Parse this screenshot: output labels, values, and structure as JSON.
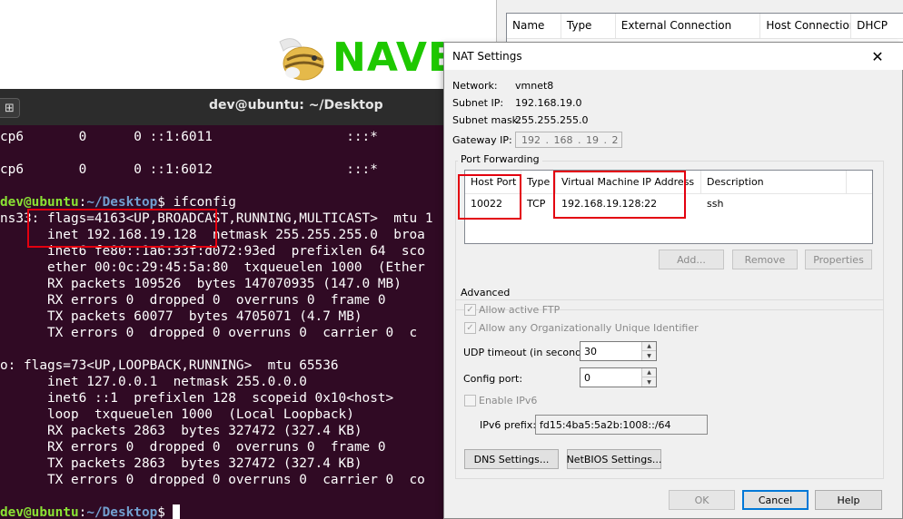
{
  "logo": {
    "text": "NAVE"
  },
  "network_list": {
    "columns": [
      "Name",
      "Type",
      "External Connection",
      "Host Connection",
      "DHCP"
    ]
  },
  "terminal": {
    "title": "dev@ubuntu: ~/Desktop",
    "prompt_user": "dev@ubuntu",
    "prompt_colon": ":",
    "prompt_path": "~/Desktop",
    "prompt_symbol": "$",
    "command": " ifconfig",
    "lines": {
      "tcp6_a": "cp6       0      0 ::1:6011                 :::*",
      "tcp6_b": "cp6       0      0 ::1:6012                 :::*",
      "ens_flags": "ns33: flags=4163<UP,BROADCAST,RUNNING,MULTICAST>  mtu 1",
      "ens_inet": "      inet 192.168.19.128  netmask 255.255.255.0  broa",
      "ens_inet6": "      inet6 fe80::1a6:33f:d072:93ed  prefixlen 64  sco",
      "ens_ether": "      ether 00:0c:29:45:5a:80  txqueuelen 1000  (Ether",
      "ens_rxp": "      RX packets 109526  bytes 147070935 (147.0 MB)",
      "ens_rxe": "      RX errors 0  dropped 0  overruns 0  frame 0",
      "ens_txp": "      TX packets 60077  bytes 4705071 (4.7 MB)",
      "ens_txe": "      TX errors 0  dropped 0 overruns 0  carrier 0  c",
      "lo_flags": "o: flags=73<UP,LOOPBACK,RUNNING>  mtu 65536",
      "lo_inet": "      inet 127.0.0.1  netmask 255.0.0.0",
      "lo_inet6": "      inet6 ::1  prefixlen 128  scopeid 0x10<host>",
      "lo_loop": "      loop  txqueuelen 1000  (Local Loopback)",
      "lo_rxp": "      RX packets 2863  bytes 327472 (327.4 KB)",
      "lo_rxe": "      RX errors 0  dropped 0  overruns 0  frame 0",
      "lo_txp": "      TX packets 2863  bytes 327472 (327.4 KB)",
      "lo_txe": "      TX errors 0  dropped 0 overruns 0  carrier 0  co"
    }
  },
  "nat_dialog": {
    "title": "NAT Settings",
    "close_glyph": "✕",
    "network_label": "Network:",
    "network_value": "vmnet8",
    "subnet_ip_label": "Subnet IP:",
    "subnet_ip_value": "192.168.19.0",
    "subnet_mask_label": "Subnet mask:",
    "subnet_mask_value": "255.255.255.0",
    "gateway_label": "Gateway IP:",
    "gateway_value": "192 . 168 . 19 . 2",
    "port_forwarding": {
      "title": "Port Forwarding",
      "columns": [
        "Host Port",
        "Type",
        "Virtual Machine IP Address",
        "Description"
      ],
      "rows": [
        {
          "host_port": "10022",
          "type": "TCP",
          "vm_ip": "192.168.19.128:22",
          "description": "ssh"
        }
      ],
      "add_label": "Add...",
      "remove_label": "Remove",
      "properties_label": "Properties"
    },
    "advanced": {
      "title": "Advanced",
      "allow_ftp_label": "Allow active FTP",
      "allow_ftp_checked": true,
      "allow_oui_label": "Allow any Organizationally Unique Identifier",
      "allow_oui_checked": true,
      "udp_timeout_label": "UDP timeout (in seconds):",
      "udp_timeout_value": "30",
      "config_port_label": "Config port:",
      "config_port_value": "0",
      "enable_ipv6_label": "Enable IPv6",
      "enable_ipv6_checked": false,
      "ipv6_prefix_label": "IPv6 prefix:",
      "ipv6_prefix_value": "fd15:4ba5:5a2b:1008::/64"
    },
    "dns_settings_label": "DNS Settings...",
    "netbios_settings_label": "NetBIOS Settings...",
    "ok_label": "OK",
    "cancel_label": "Cancel",
    "help_label": "Help"
  },
  "colors": {
    "terminal_bg": "#300a24",
    "prompt_user": "#8ae234",
    "prompt_path": "#729fcf",
    "highlight_box": "#e3000f",
    "logo_green": "#1ec800"
  }
}
